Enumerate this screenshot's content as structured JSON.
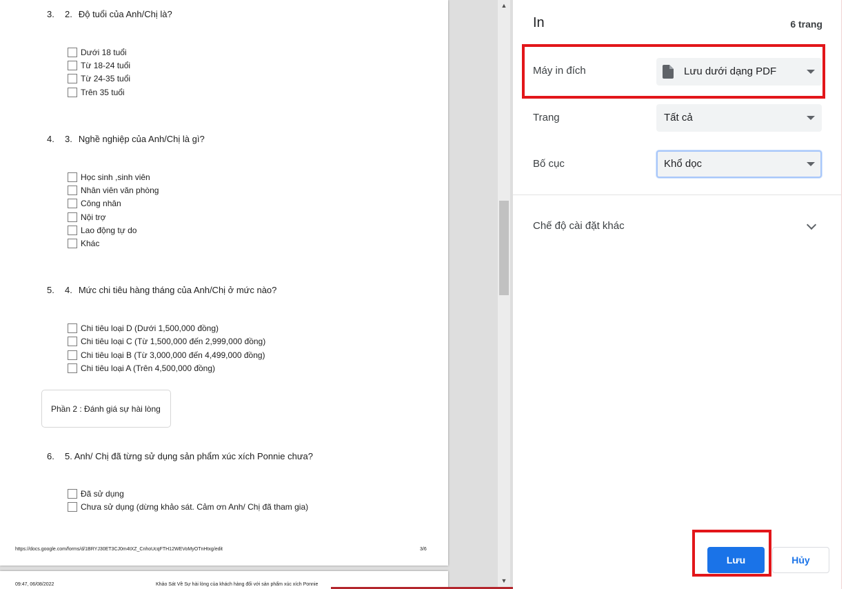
{
  "preview": {
    "questions": [
      {
        "number": "3.",
        "sub": "2.",
        "text": "Độ tuổi của Anh/Chị là?",
        "options": [
          "Dưới 18 tuổi",
          "Từ 18-24 tuổi",
          "Từ 24-35 tuổi",
          "Trên 35 tuổi"
        ]
      },
      {
        "number": "4.",
        "sub": "3.",
        "text": "Nghề nghiệp của Anh/Chị là gì?",
        "options": [
          "Học sinh ,sinh viên",
          "Nhân viên văn phòng",
          "Công nhân",
          "Nội trợ",
          "Lao động tự do",
          "Khác"
        ]
      },
      {
        "number": "5.",
        "sub": "4.",
        "text": "Mức chi tiêu hàng tháng của Anh/Chị ở mức nào?",
        "options": [
          "Chi tiêu loại D (Dưới 1,500,000 đồng)",
          "Chi tiêu loại C (Từ 1,500,000 đến 2,999,000 đồng)",
          "Chi tiêu loại B (Từ 3,000,000 đến 4,499,000 đồng)",
          "Chi tiêu loại A (Trên 4,500,000 đồng)"
        ]
      },
      {
        "number": "6.",
        "sub": "",
        "text": "5. Anh/ Chị đã từng sử dụng sản phẩm xúc xích Ponnie chưa?",
        "options": [
          "Đã sử dụng",
          "Chưa sử dụng (dừng khảo sát. Cảm ơn Anh/ Chị đã tham gia)"
        ]
      }
    ],
    "section_label": "Phần 2 : Đánh giá sự hài lòng",
    "footer_url": "https://docs.google.com/forms/d/1BRYJ30ET3CJ0m4tXZ_CnhoUcqFTH12WEVoMyOTnHtxg/edit",
    "footer_page": "3/6",
    "next_page_time": "09:47, 06/08/2022",
    "next_page_title": "Khảo Sát Về Sự hài lòng của khách hàng đối với sản phẩm xúc xích Ponnie"
  },
  "settings": {
    "title": "In",
    "page_count": "6 trang",
    "destination_label": "Máy in đích",
    "destination_value": "Lưu dưới dạng PDF",
    "pages_label": "Trang",
    "pages_value": "Tất cả",
    "layout_label": "Bố cục",
    "layout_value": "Khổ dọc",
    "more_settings_label": "Chế độ cài đặt khác",
    "save_label": "Lưu",
    "cancel_label": "Hủy",
    "icons": {
      "document": "document-icon",
      "dropdown": "arrow-drop-down-icon",
      "expand": "chevron-down-icon"
    }
  },
  "colors": {
    "accent": "#1a73e8",
    "highlight": "#e2161a"
  }
}
